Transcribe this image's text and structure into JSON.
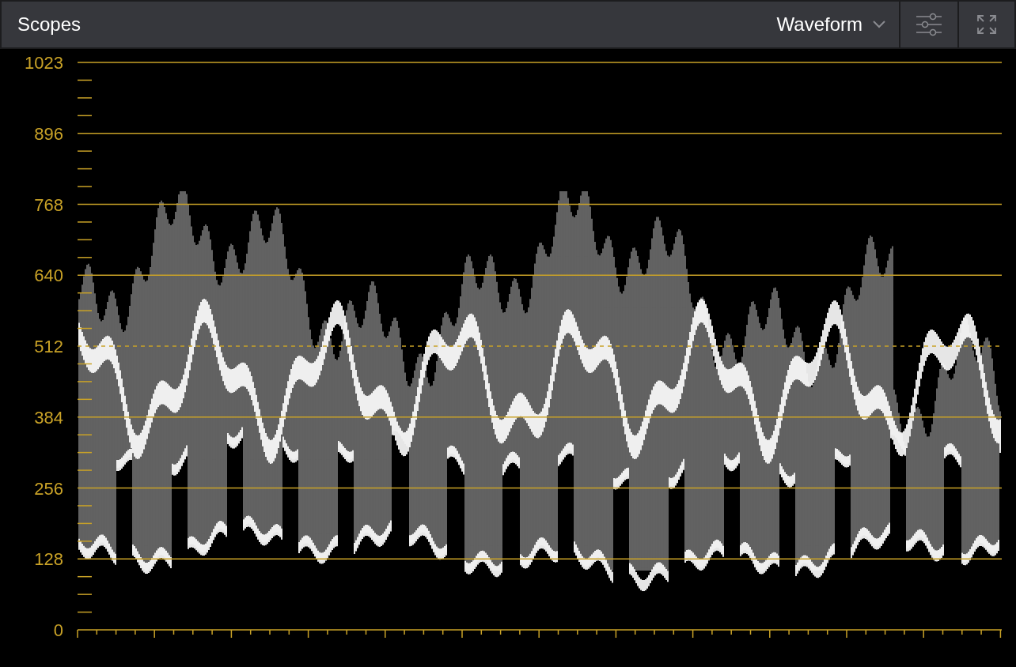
{
  "panel": {
    "title": "Scopes"
  },
  "scope_mode": {
    "value": "Waveform"
  },
  "scale_labels": [
    "1023",
    "896",
    "768",
    "640",
    "512",
    "384",
    "256",
    "128",
    "0"
  ]
}
